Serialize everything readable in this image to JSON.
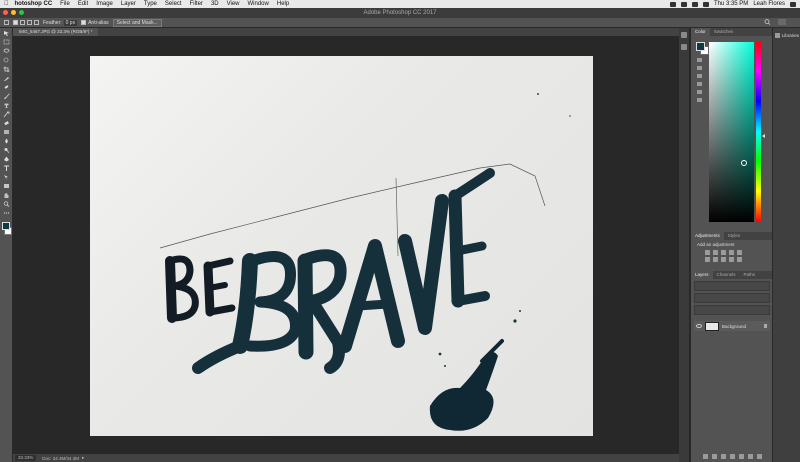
{
  "menubar": {
    "app": "hotoshop CC",
    "items": [
      "File",
      "Edit",
      "Image",
      "Layer",
      "Type",
      "Select",
      "Filter",
      "3D",
      "View",
      "Window",
      "Help"
    ],
    "time": "Thu 3:35 PM",
    "user": "Leah Flores"
  },
  "window": {
    "title": "Adobe Photoshop CC 2017"
  },
  "options": {
    "feather_label": "Feather:",
    "feather_value": "0 px",
    "antialias_label": "Anti-alias",
    "select_mask_label": "Select and Mask..."
  },
  "document": {
    "tab": "IMG_5487.JPG @ 33.3% (RGB/8*) *"
  },
  "status": {
    "zoom": "33.33%",
    "doc": "Doc: 34.3M/34.3M"
  },
  "artwork": {
    "word1": "BE",
    "word2": "BRAVE"
  },
  "panels": {
    "color_tabs": [
      "Color",
      "Swatches"
    ],
    "adjust_tabs": [
      "Adjustments",
      "Styles"
    ],
    "adjust_label": "Add an adjustment",
    "layers_tabs": [
      "Layers",
      "Channels",
      "Paths"
    ],
    "layer_name": "Background",
    "libraries": "Libraries"
  },
  "colors": {
    "foreground": "#0c3a45",
    "paint": "#16303b"
  }
}
